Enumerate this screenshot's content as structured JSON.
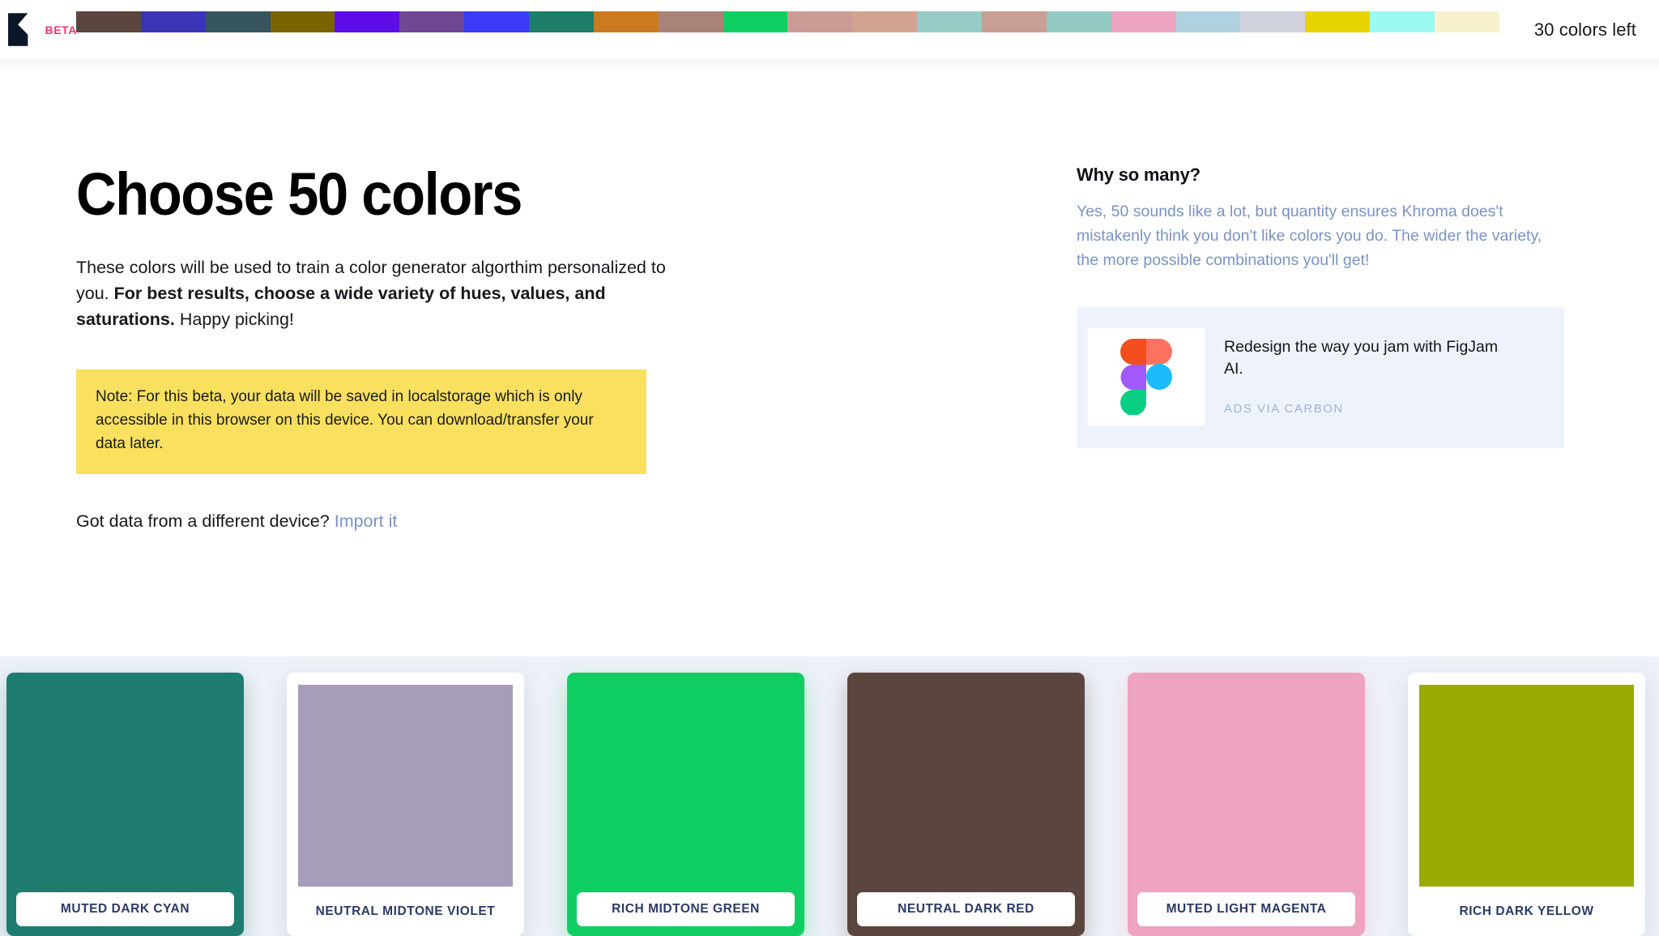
{
  "header": {
    "logo_name": "khroma-logo",
    "beta_label": "BETA",
    "colors_left": "30 colors left",
    "strip_colors": [
      "#5b453f",
      "#3b35b5",
      "#36555f",
      "#7a6400",
      "#5d0ce8",
      "#6f4795",
      "#3b3bf5",
      "#1e7d68",
      "#cb7a22",
      "#a98378",
      "#0fcf62",
      "#cb9b96",
      "#d3a392",
      "#97cbc5",
      "#c99f94",
      "#93c9c3",
      "#eea4c0",
      "#b0d2e0",
      "#cfd2dd",
      "#e8d400",
      "#9bfbf2",
      "#f7f2cd"
    ]
  },
  "main": {
    "title": "Choose 50 colors",
    "intro": {
      "part1": "These colors will be used to train a color generator algorthim personalized to you. ",
      "bold": "For best results, choose a wide variety of hues, values, and saturations.",
      "part2": " Happy picking!"
    },
    "note": "Note: For this beta, your data will be saved in localstorage which is only accessible in this browser on this device. You can download/transfer your data later.",
    "note_bg": "#f9e05e",
    "import_prompt": "Got data from a different device?",
    "import_link": "Import it",
    "import_link_color": "#7b93c4"
  },
  "sidebar": {
    "why_title": "Why so many?",
    "why_body": "Yes, 50 sounds like a lot, but quantity ensures Khroma does't mistakenly think you don't like colors you do. The wider the variety, the more possible combinations you'll get!",
    "ad": {
      "logo_name": "figma-logo",
      "headline": "Redesign the way you jam with FigJam AI.",
      "source": "ADS VIA CARBON",
      "bg": "#eef3fb"
    }
  },
  "cards": {
    "tray_bg": "#eef1f8",
    "items": [
      {
        "label": "MUTED DARK CYAN",
        "color": "#1e7d6f",
        "selected": true
      },
      {
        "label": "NEUTRAL MIDTONE VIOLET",
        "color": "#a79dba",
        "selected": false
      },
      {
        "label": "RICH MIDTONE GREEN",
        "color": "#0ece62",
        "selected": true
      },
      {
        "label": "NEUTRAL DARK RED",
        "color": "#5b453f",
        "selected": true
      },
      {
        "label": "MUTED LIGHT MAGENTA",
        "color": "#eea4c0",
        "selected": true
      },
      {
        "label": "RICH DARK YELLOW",
        "color": "#99ab05",
        "selected": false
      }
    ]
  }
}
